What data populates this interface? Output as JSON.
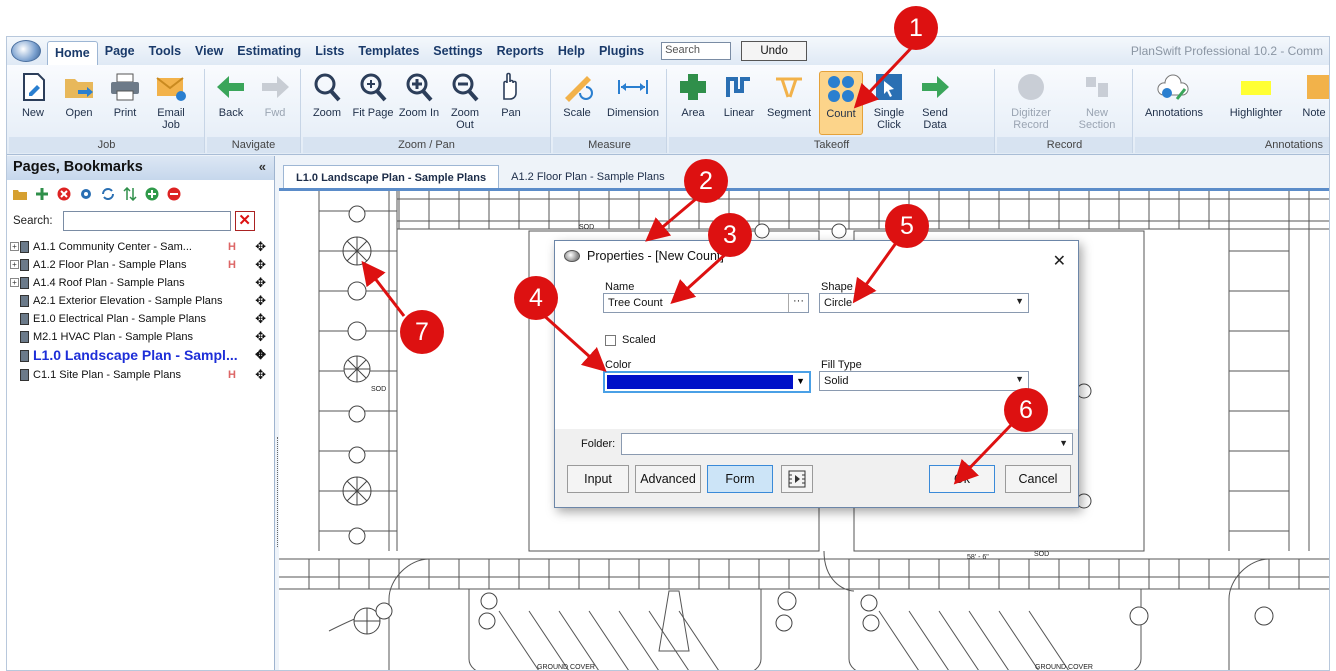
{
  "menubar": {
    "items": [
      "Home",
      "Page",
      "Tools",
      "View",
      "Estimating",
      "Lists",
      "Templates",
      "Settings",
      "Reports",
      "Help",
      "Plugins"
    ],
    "search_placeholder": "Search",
    "undo_label": "Undo",
    "app_title": "PlanSwift Professional 10.2 - Comm"
  },
  "ribbon": {
    "groups": {
      "job": "Job",
      "navigate": "Navigate",
      "zoom": "Zoom / Pan",
      "measure": "Measure",
      "takeoff": "Takeoff",
      "record": "Record",
      "annotations": "Annotations"
    },
    "buttons": {
      "new": "New",
      "open": "Open",
      "print": "Print",
      "email": "Email Job",
      "back": "Back",
      "fwd": "Fwd",
      "zoom": "Zoom",
      "fit": "Fit Page",
      "zoom_in": "Zoom In",
      "zoom_out": "Zoom Out",
      "pan": "Pan",
      "scale": "Scale",
      "dimension": "Dimension",
      "area": "Area",
      "linear": "Linear",
      "segment": "Segment",
      "count": "Count",
      "single_click": "Single Click",
      "send_data": "Send Data",
      "digitizer": "Digitizer Record",
      "new_section": "New Section",
      "annotations": "Annotations",
      "highlighter": "Highlighter",
      "note": "Note"
    }
  },
  "sidebar": {
    "title": "Pages, Bookmarks",
    "collapse": "«",
    "search_label": "Search:",
    "pages": [
      "A1.1 Community Center - Sam...",
      "A1.2 Floor Plan - Sample Plans",
      "A1.4 Roof Plan - Sample Plans",
      "A2.1 Exterior Elevation - Sample Plans",
      "E1.0 Electrical Plan - Sample Plans",
      "M2.1 HVAC Plan - Sample Plans",
      "L1.0 Landscape Plan - Sampl...",
      "C1.1 Site Plan - Sample Plans"
    ]
  },
  "tabs": [
    "L1.0 Landscape Plan - Sample Plans",
    "A1.2 Floor Plan - Sample Plans"
  ],
  "plan_labels": {
    "sod": "SOD",
    "ground_cover": "GROUND COVER",
    "dimension": "58' - 6\""
  },
  "dialog": {
    "title": "Properties - [New Count]",
    "name_label": "Name",
    "name_value": "Tree Count",
    "dots": "···",
    "shape_label": "Shape",
    "shape_value": "Circle",
    "scaled_label": "Scaled",
    "color_label": "Color",
    "color_value": "#0010c8",
    "fill_label": "Fill Type",
    "fill_value": "Solid",
    "folder_label": "Folder:",
    "buttons": {
      "input": "Input",
      "advanced": "Advanced",
      "form": "Form",
      "ok": "Ok",
      "cancel": "Cancel"
    }
  },
  "callouts": [
    "1",
    "2",
    "3",
    "4",
    "5",
    "6",
    "7"
  ],
  "colors": {
    "callout": "#dd1111",
    "accent": "#5b8cc9",
    "selected": "#fcd48a"
  }
}
